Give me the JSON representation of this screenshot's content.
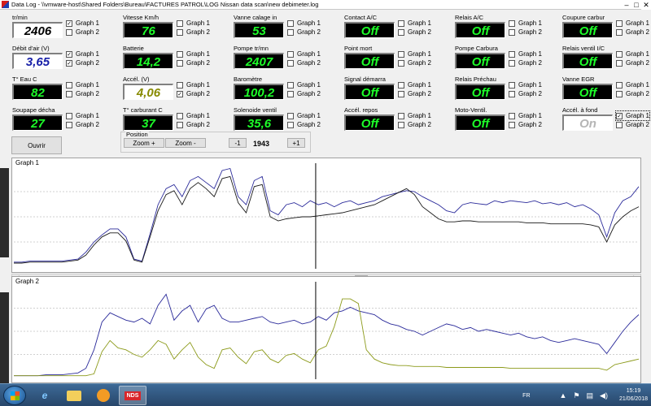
{
  "window": {
    "title": "Data Log - \\\\vmware-host\\Shared Folders\\Bureau\\FACTURES PATROL\\LOG Nissan data scan\\new debimeter.log",
    "minimize": "–",
    "maximize": "□",
    "close": "✕"
  },
  "gauges": [
    {
      "label": "tr/min",
      "value": "2406",
      "style": "white",
      "g1": true,
      "g2": false
    },
    {
      "label": "Vitesse Km/h",
      "value": "76",
      "style": "green",
      "g1": false,
      "g2": false
    },
    {
      "label": "Vanne calage in",
      "value": "53",
      "style": "green",
      "g1": false,
      "g2": false
    },
    {
      "label": "Contact A/C",
      "value": "Off",
      "style": "green",
      "g1": false,
      "g2": false
    },
    {
      "label": "Relais A/C",
      "value": "Off",
      "style": "green",
      "g1": false,
      "g2": false
    },
    {
      "label": "Coupure carbur",
      "value": "Off",
      "style": "green",
      "g1": false,
      "g2": false
    },
    {
      "label": "Débit d'air (V)",
      "value": "3,65",
      "style": "blue",
      "g1": true,
      "g2": true
    },
    {
      "label": "Batterie",
      "value": "14,2",
      "style": "green",
      "g1": false,
      "g2": false
    },
    {
      "label": "Pompe tr/mn",
      "value": "2407",
      "style": "green",
      "g1": false,
      "g2": false
    },
    {
      "label": "Point mort",
      "value": "Off",
      "style": "green",
      "g1": false,
      "g2": false
    },
    {
      "label": "Pompe Carbura",
      "value": "Off",
      "style": "green",
      "g1": false,
      "g2": false
    },
    {
      "label": "Relais ventil I/C",
      "value": "Off",
      "style": "green",
      "g1": false,
      "g2": false
    },
    {
      "label": "T° Eau C",
      "value": "82",
      "style": "green",
      "g1": false,
      "g2": false
    },
    {
      "label": "Accél. (V)",
      "value": "4,06",
      "style": "olive",
      "g1": false,
      "g2": true
    },
    {
      "label": "Baromètre",
      "value": "100,2",
      "style": "green",
      "g1": false,
      "g2": false
    },
    {
      "label": "Signal démarra",
      "value": "Off",
      "style": "green",
      "g1": false,
      "g2": false
    },
    {
      "label": "Relais Préchau",
      "value": "Off",
      "style": "green",
      "g1": false,
      "g2": false
    },
    {
      "label": "Vanne EGR",
      "value": "Off",
      "style": "green",
      "g1": false,
      "g2": false
    },
    {
      "label": "Soupape décha",
      "value": "27",
      "style": "green",
      "g1": false,
      "g2": false
    },
    {
      "label": "T° carburant C",
      "value": "37",
      "style": "green",
      "g1": false,
      "g2": false
    },
    {
      "label": "Solenoide ventil",
      "value": "35,6",
      "style": "green",
      "g1": false,
      "g2": false
    },
    {
      "label": "Accél. repos",
      "value": "Off",
      "style": "green",
      "g1": false,
      "g2": false
    },
    {
      "label": "Moto-Ventil.",
      "value": "Off",
      "style": "green",
      "g1": false,
      "g2": false
    },
    {
      "label": "Accél. à fond",
      "value": "On",
      "style": "grayoff",
      "g1": true,
      "g2": false
    }
  ],
  "checkbox_labels": {
    "graph1": "Graph 1",
    "graph2": "Graph 2"
  },
  "controls": {
    "open": "Ouvrir",
    "position_label": "Position",
    "zoom_in": "Zoom +",
    "zoom_out": "Zoom -",
    "step_back": "-1",
    "position_value": "1943",
    "step_forward": "+1"
  },
  "graphs": {
    "graph1_title": "Graph 1",
    "graph2_title": "Graph 2"
  },
  "taskbar": {
    "lang": "FR",
    "time": "15:19",
    "date": "21/06/2018",
    "app_badge": "NDS"
  },
  "colors": {
    "series_blue": "#2a2a9a",
    "series_black": "#1a1a1a",
    "series_olive": "#8c9a1a",
    "gauge_green": "#1dff29"
  },
  "chart_data": [
    {
      "type": "line",
      "title": "Graph 1",
      "grid": true,
      "series": [
        {
          "name": "",
          "color": "#2a2a9a",
          "values": [
            0.05,
            0.05,
            0.06,
            0.06,
            0.06,
            0.06,
            0.06,
            0.07,
            0.08,
            0.15,
            0.25,
            0.32,
            0.38,
            0.38,
            0.3,
            0.08,
            0.06,
            0.33,
            0.62,
            0.78,
            0.82,
            0.7,
            0.86,
            0.9,
            0.84,
            0.78,
            0.96,
            0.98,
            0.7,
            0.62,
            0.86,
            0.9,
            0.56,
            0.52,
            0.62,
            0.64,
            0.6,
            0.66,
            0.62,
            0.64,
            0.6,
            0.64,
            0.66,
            0.62,
            0.64,
            0.66,
            0.7,
            0.72,
            0.74,
            0.76,
            0.75,
            0.7,
            0.66,
            0.62,
            0.56,
            0.54,
            0.62,
            0.64,
            0.63,
            0.62,
            0.66,
            0.64,
            0.66,
            0.65,
            0.64,
            0.66,
            0.63,
            0.64,
            0.62,
            0.64,
            0.6,
            0.62,
            0.58,
            0.52,
            0.3,
            0.54,
            0.66,
            0.7,
            0.8
          ]
        },
        {
          "name": "",
          "color": "#1a1a1a",
          "values": [
            0.04,
            0.04,
            0.05,
            0.05,
            0.05,
            0.05,
            0.05,
            0.06,
            0.07,
            0.12,
            0.22,
            0.3,
            0.34,
            0.34,
            0.26,
            0.07,
            0.05,
            0.3,
            0.56,
            0.72,
            0.76,
            0.62,
            0.78,
            0.84,
            0.78,
            0.7,
            0.88,
            0.9,
            0.64,
            0.54,
            0.8,
            0.82,
            0.5,
            0.46,
            0.48,
            0.49,
            0.5,
            0.5,
            0.51,
            0.52,
            0.53,
            0.54,
            0.56,
            0.58,
            0.6,
            0.62,
            0.66,
            0.7,
            0.74,
            0.78,
            0.72,
            0.6,
            0.54,
            0.48,
            0.45,
            0.45,
            0.46,
            0.46,
            0.45,
            0.45,
            0.45,
            0.45,
            0.45,
            0.45,
            0.44,
            0.44,
            0.44,
            0.43,
            0.43,
            0.43,
            0.43,
            0.43,
            0.42,
            0.4,
            0.25,
            0.42,
            0.5,
            0.56,
            0.6
          ]
        }
      ]
    },
    {
      "type": "line",
      "title": "Graph 2",
      "grid": true,
      "series": [
        {
          "name": "",
          "color": "#2a2a9a",
          "values": [
            0.02,
            0.02,
            0.02,
            0.02,
            0.03,
            0.03,
            0.03,
            0.04,
            0.05,
            0.1,
            0.3,
            0.6,
            0.7,
            0.66,
            0.62,
            0.6,
            0.64,
            0.58,
            0.78,
            0.9,
            0.62,
            0.72,
            0.78,
            0.6,
            0.74,
            0.78,
            0.64,
            0.6,
            0.6,
            0.62,
            0.64,
            0.66,
            0.6,
            0.58,
            0.6,
            0.62,
            0.58,
            0.6,
            0.66,
            0.62,
            0.7,
            0.72,
            0.76,
            0.72,
            0.7,
            0.68,
            0.62,
            0.58,
            0.56,
            0.52,
            0.5,
            0.46,
            0.5,
            0.54,
            0.58,
            0.56,
            0.52,
            0.54,
            0.5,
            0.52,
            0.5,
            0.48,
            0.46,
            0.48,
            0.44,
            0.42,
            0.44,
            0.4,
            0.38,
            0.4,
            0.42,
            0.4,
            0.38,
            0.36,
            0.26,
            0.38,
            0.5,
            0.6,
            0.68
          ]
        },
        {
          "name": "",
          "color": "#8c9a1a",
          "values": [
            0.02,
            0.02,
            0.02,
            0.02,
            0.02,
            0.02,
            0.02,
            0.02,
            0.02,
            0.02,
            0.04,
            0.28,
            0.4,
            0.32,
            0.3,
            0.25,
            0.22,
            0.3,
            0.4,
            0.36,
            0.2,
            0.3,
            0.38,
            0.22,
            0.14,
            0.1,
            0.3,
            0.32,
            0.22,
            0.15,
            0.28,
            0.3,
            0.2,
            0.16,
            0.24,
            0.26,
            0.2,
            0.16,
            0.3,
            0.34,
            0.55,
            0.85,
            0.85,
            0.8,
            0.3,
            0.2,
            0.16,
            0.14,
            0.13,
            0.13,
            0.12,
            0.12,
            0.12,
            0.12,
            0.11,
            0.11,
            0.11,
            0.11,
            0.11,
            0.11,
            0.11,
            0.11,
            0.1,
            0.1,
            0.1,
            0.1,
            0.1,
            0.1,
            0.1,
            0.1,
            0.1,
            0.1,
            0.1,
            0.1,
            0.08,
            0.14,
            0.16,
            0.18,
            0.2
          ]
        }
      ]
    }
  ]
}
